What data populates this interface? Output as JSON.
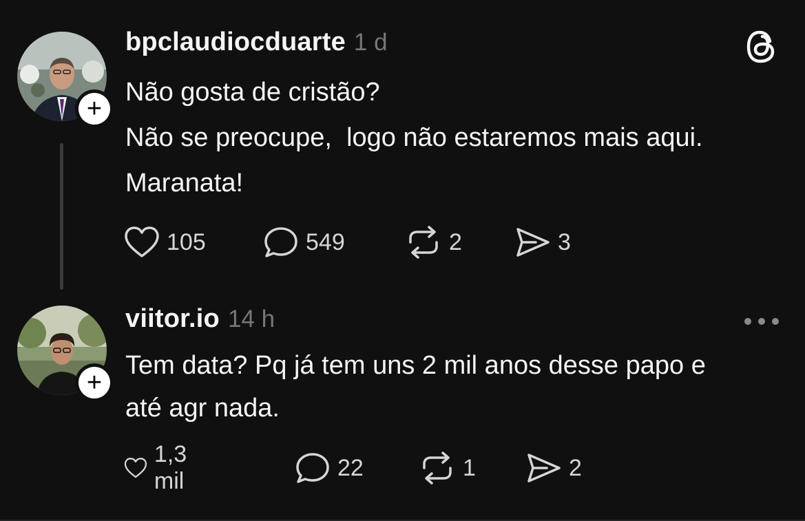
{
  "posts": [
    {
      "username": "bpclaudiocduarte",
      "time": "1 d",
      "lines": [
        "Não gosta de cristão?",
        "Não se preocupe,  logo não estaremos mais aqui.",
        "Maranata!"
      ],
      "likes": "105",
      "comments": "549",
      "reposts": "2",
      "shares": "3"
    },
    {
      "username": "viitor.io",
      "time": "14 h",
      "lines": [
        "Tem data? Pq já tem uns 2 mil anos desse papo e",
        "até agr nada."
      ],
      "likes": "1,3 mil",
      "comments": "22",
      "reposts": "1",
      "shares": "2"
    }
  ],
  "icons": {
    "follow": "plus-icon",
    "like": "heart-icon",
    "comment": "comment-icon",
    "repost": "repost-icon",
    "share": "send-icon",
    "logo": "threads-logo-icon",
    "more": "more-dots-icon"
  },
  "colors": {
    "background": "#101010",
    "text": "#f3f5f7",
    "muted": "#777777",
    "action": "#d6d6d6"
  }
}
